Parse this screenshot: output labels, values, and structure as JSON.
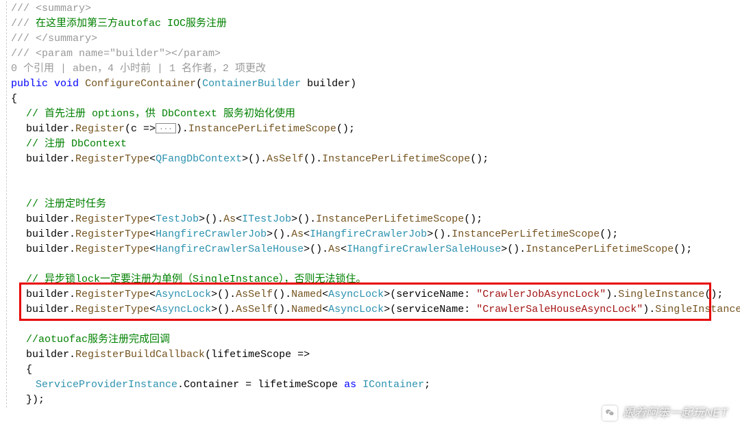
{
  "doc": {
    "l1a": "/// <summary>",
    "l2a": "/// ",
    "l2b": "在这里添加第三方autofac IOC服务注册",
    "l3a": "/// </summary>",
    "l4a": "/// <param name=\"builder\"></param>"
  },
  "codelens": "0 个引用 | aben，4 小时前 | 1 名作者，2 项更改",
  "sig": {
    "public": "public",
    "void": "void",
    "method": "ConfigureContainer",
    "paramType": "ContainerBuilder",
    "paramName": "builder"
  },
  "braceOpen": "{",
  "braceClose": "}",
  "options": {
    "comment": "// 首先注册 options，供 DbContext 服务初始化使用",
    "b": "builder",
    "dot": ".",
    "reg": "Register",
    "lam": "(c =>",
    "box": "...",
    "tail": ").",
    "iplscope": "InstancePerLifetimeScope",
    "end": "();"
  },
  "dbc": {
    "comment": "// 注册 DbContext",
    "b": "builder",
    "dot": ".",
    "regtype": "RegisterType",
    "lt": "<",
    "qfang": "QFangDbContext",
    "gt": ">",
    "unit": "().",
    "asself": "AsSelf",
    "dot2": "().",
    "iplscope": "InstancePerLifetimeScope",
    "end": "();"
  },
  "jobs": {
    "comment": "// 注册定时任务",
    "b": "builder",
    "regtype": "RegisterType",
    "as": "As",
    "ipls": "InstancePerLifetimeScope",
    "testjob": "TestJob",
    "itestjob": "ITestJob",
    "hfc": "HangfireCrawlerJob",
    "ihfc": "IHangfireCrawlerJob",
    "hfcs": "HangfireCrawlerSaleHouse",
    "ihfcs": "IHangfireCrawlerSaleHouse"
  },
  "asynclock": {
    "comment": "// 异步锁lock一定要注册为单例（SingleInstance），否则无法锁住。",
    "b": "builder",
    "regtype": "RegisterType",
    "al": "AsyncLock",
    "asself": "AsSelf",
    "named": "Named",
    "svc": "(serviceName: ",
    "s1": "\"CrawlerJobAsyncLock\"",
    "s2": "\"CrawlerSaleHouseAsyncLock\"",
    "close": ").",
    "single": "SingleInstance",
    "end": "();"
  },
  "cb": {
    "comment": "//aotuofac服务注册完成回调",
    "b": "builder",
    "rbc": "RegisterBuildCallback",
    "lam": "(lifetimeScope =>",
    "open": "{",
    "spi": "ServiceProviderInstance",
    "dot": ".",
    "cont": "Container",
    "eq": " = lifetimeScope ",
    "as": "as",
    "space": " ",
    "ic": "IContainer",
    "semi": ";",
    "close": "});"
  },
  "watermark": "跟着阿笨一起玩NET"
}
